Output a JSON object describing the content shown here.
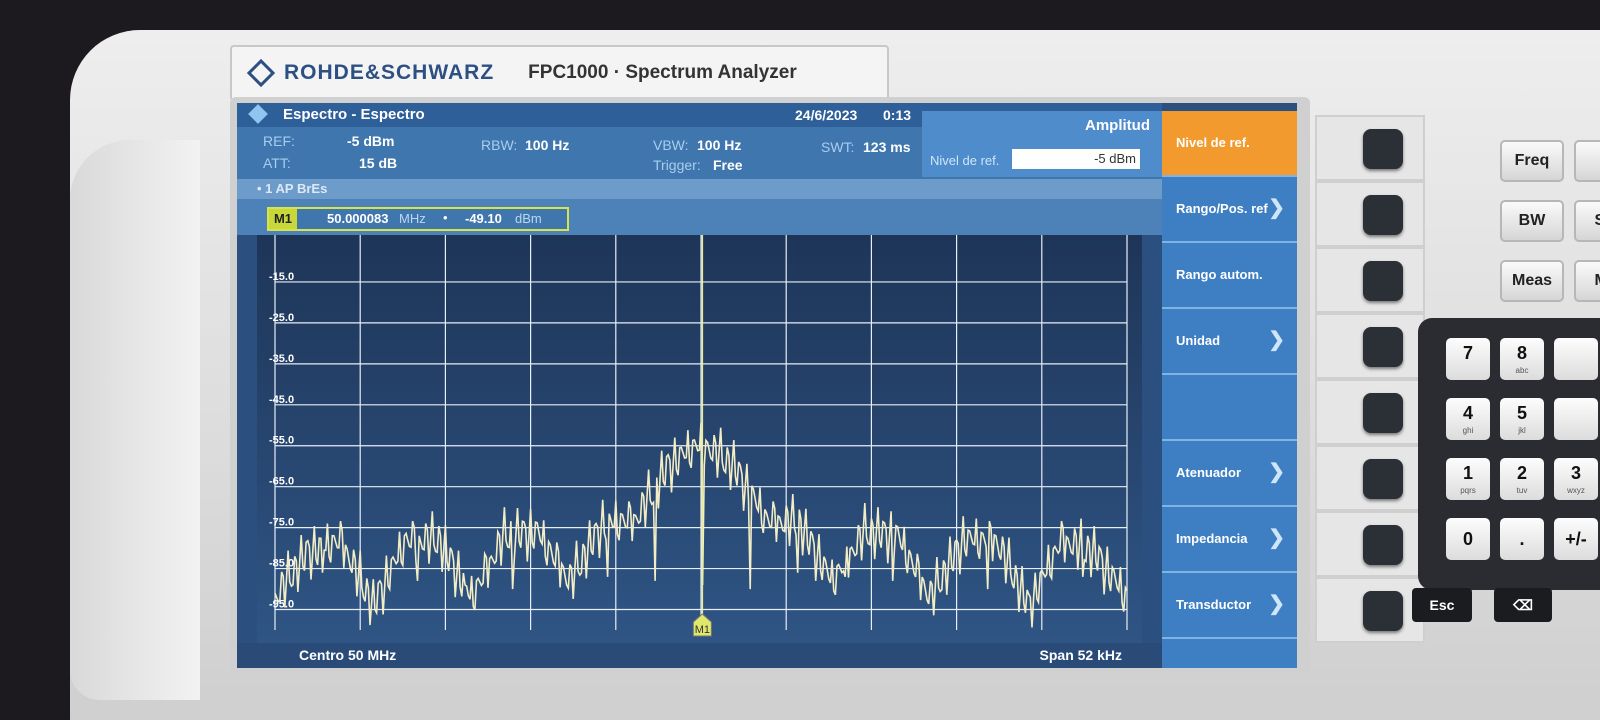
{
  "device": {
    "brand": "ROHDE&SCHWARZ",
    "model": "FPC1000 · Spectrum Analyzer"
  },
  "header": {
    "title": "Espectro - Espectro",
    "date": "24/6/2023",
    "time": "0:13"
  },
  "params": {
    "ref_label": "REF:",
    "ref_value": "-5 dBm",
    "att_label": "ATT:",
    "att_value": "15 dB",
    "rbw_label": "RBW:",
    "rbw_value": "100 Hz",
    "vbw_label": "VBW:",
    "vbw_value": "100 Hz",
    "trigger_label": "Trigger:",
    "trigger_value": "Free",
    "swt_label": "SWT:",
    "swt_value": "123 ms"
  },
  "amplitude_panel": {
    "title": "Amplitud",
    "ref_level_label": "Nivel de ref.",
    "ref_level_value": "-5 dBm"
  },
  "trace_info": "• 1 AP  BrEs",
  "marker": {
    "tag": "M1",
    "frequency": "50.000083",
    "frequency_unit": "MHz",
    "separator": "•",
    "level": "-49.10",
    "level_unit": "dBm"
  },
  "plot": {
    "y_ticks": [
      "-15.0",
      "-25.0",
      "-35.0",
      "-45.0",
      "-55.0",
      "-65.0",
      "-75.0",
      "-85.0",
      "-95.0"
    ],
    "center_label": "Centro 50 MHz",
    "span_label": "Span 52 kHz",
    "marker_flag": "M1"
  },
  "chart_data": {
    "type": "line",
    "center_frequency_mhz": 50,
    "span_khz": 52,
    "ylim": [
      -100,
      -5
    ],
    "grid": true,
    "marker": {
      "frequency_mhz": 50.000083,
      "level_dbm": -49.1
    },
    "series": [
      {
        "x": [
          -26,
          -24,
          -22,
          -20,
          -18,
          -16,
          -14,
          -12,
          -10,
          -8,
          -6,
          -4,
          -2,
          0,
          2,
          4,
          6,
          8,
          10,
          12,
          14,
          16,
          18,
          20,
          22,
          24,
          26
        ],
        "values": [
          -88,
          -77,
          -74,
          -90,
          -74,
          -74,
          -88,
          -73,
          -72,
          -84,
          -70,
          -69,
          -56,
          -50,
          -56,
          -69,
          -70,
          -84,
          -72,
          -73,
          -88,
          -74,
          -74,
          -90,
          -74,
          -77,
          -88
        ]
      }
    ]
  },
  "softkeys": [
    {
      "label": "Nivel de ref.",
      "chevron": ""
    },
    {
      "label": "Rango/Pos. ref",
      "chevron": "❯"
    },
    {
      "label": "Rango autom.",
      "chevron": ""
    },
    {
      "label": "Unidad",
      "chevron": "❯"
    },
    {
      "label": "",
      "chevron": ""
    },
    {
      "label": "Atenuador",
      "chevron": "❯"
    },
    {
      "label": "Impedancia",
      "chevron": "❯"
    },
    {
      "label": "Transductor",
      "chevron": "❯"
    }
  ],
  "right_keys": {
    "freq": "Freq",
    "bw": "BW",
    "meas": "Meas",
    "sw": "Sw",
    "mod": "Mo",
    "s": "S"
  },
  "numpad": {
    "k7": "7",
    "k8": "8",
    "k8s": "abc",
    "k4": "4",
    "k4s": "ghi",
    "k5": "5",
    "k5s": "jkl",
    "k1": "1",
    "k1s": "pqrs",
    "k2": "2",
    "k2s": "tuv",
    "k3": "3",
    "k3s": "wxyz",
    "k0": "0",
    "kdot": ".",
    "kpm": "+/-",
    "esc": "Esc",
    "back": "⌫"
  }
}
